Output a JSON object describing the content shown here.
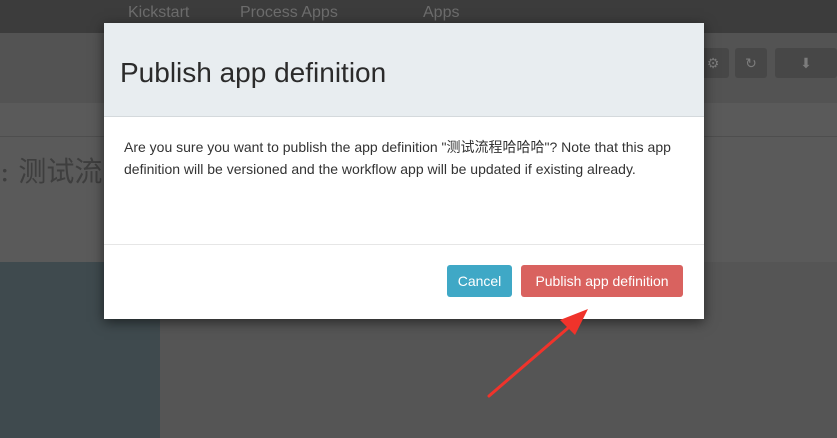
{
  "background": {
    "nav": {
      "items": [
        "Kickstart",
        "Process Apps",
        "Apps"
      ]
    },
    "page_title": ": 测试流"
  },
  "dialog": {
    "title": "Publish app definition",
    "message": "Are you sure you want to publish the app definition \"测试流程哈哈哈\"? Note that this app definition will be versioned and the workflow app will be updated if existing already.",
    "cancel_label": "Cancel",
    "publish_label": "Publish app definition"
  },
  "colors": {
    "cancel_button": "#3fa8c6",
    "publish_button": "#d9625f",
    "annotation_arrow": "#f0332b"
  }
}
